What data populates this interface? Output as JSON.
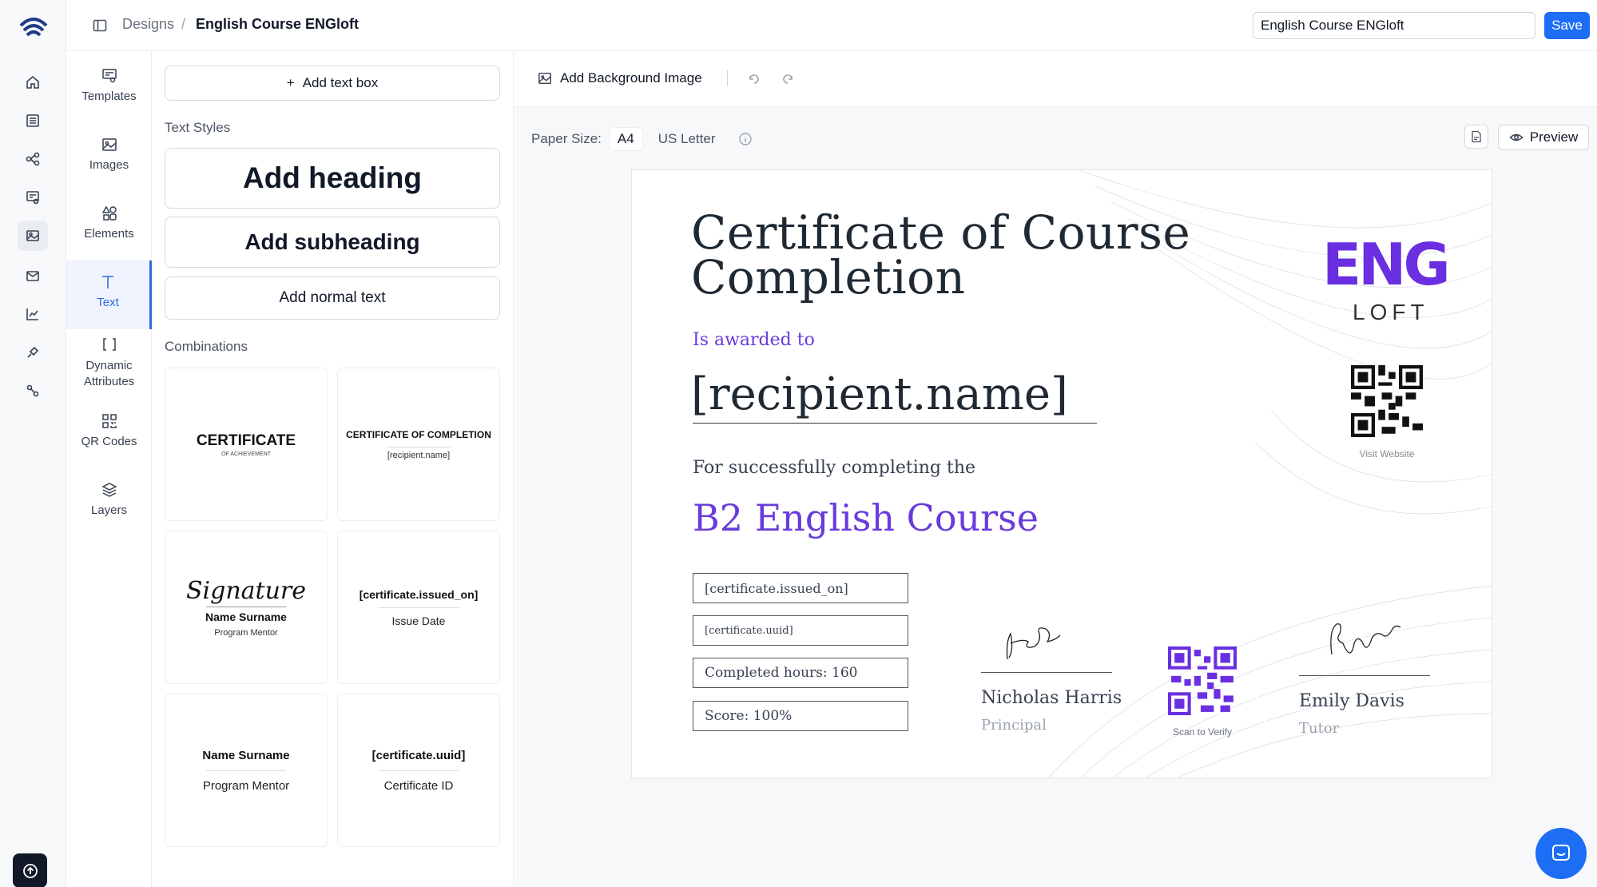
{
  "breadcrumb": {
    "root": "Designs",
    "separator": "/",
    "current": "English Course ENGloft"
  },
  "header": {
    "title_value": "English Course ENGloft",
    "save_label": "Save"
  },
  "rail": {
    "items": [
      "home-icon",
      "list-icon",
      "hierarchy-icon",
      "certificate-icon",
      "image-icon",
      "mail-icon",
      "chart-icon",
      "integration-icon",
      "link-icon"
    ],
    "active_index": 4
  },
  "tooltabs": [
    {
      "label": "Templates",
      "icon": "templates-icon"
    },
    {
      "label": "Images",
      "icon": "image-icon"
    },
    {
      "label": "Elements",
      "icon": "shapes-icon"
    },
    {
      "label": "Text",
      "icon": "text-icon"
    },
    {
      "label": "Dynamic Attributes",
      "icon": "brackets-icon"
    },
    {
      "label": "QR Codes",
      "icon": "qr-icon"
    },
    {
      "label": "Layers",
      "icon": "layers-icon"
    }
  ],
  "panel": {
    "add_text_box": "Add text box",
    "text_styles_label": "Text Styles",
    "add_heading": "Add heading",
    "add_subheading": "Add subheading",
    "add_normal": "Add normal text",
    "combinations_label": "Combinations",
    "combos": {
      "c1_title": "CERTIFICATE",
      "c1_sub": "OF ACHIEVEMENT",
      "c2_title": "CERTIFICATE OF COMPLETION",
      "c2_sub": "[recipient.name]",
      "c3_script": "Signature",
      "c3_name": "Name Surname",
      "c3_role": "Program Mentor",
      "c4_title": "[certificate.issued_on]",
      "c4_sub": "Issue Date",
      "c5_name": "Name Surname",
      "c5_role": "Program Mentor",
      "c6_title": "[certificate.uuid]",
      "c6_sub": "Certificate ID"
    }
  },
  "toolbar": {
    "background_label": "Add Background Image"
  },
  "paper": {
    "label": "Paper Size:",
    "options": [
      "A4",
      "US Letter"
    ],
    "selected": "A4",
    "preview_label": "Preview"
  },
  "certificate": {
    "title_line1": "Certificate of Course",
    "title_line2": "Completion",
    "awarded": "Is awarded to",
    "recipient": "[recipient.name]",
    "completing": "For successfully completing the",
    "course": "B2 English Course",
    "field_issued": "[certificate.issued_on]",
    "field_uuid": "[certificate.uuid]",
    "field_hours": "Completed hours: 160",
    "field_score": "Score: 100%",
    "signer1_name": "Nicholas Harris",
    "signer1_role": "Principal",
    "signer2_name": "Emily Davis",
    "signer2_role": "Tutor",
    "qr_verify_label": "Scan to Verify",
    "qr_website_label": "Visit Website",
    "logo_top": "ENG",
    "logo_bottom": "LOFT"
  },
  "colors": {
    "accent": "#1d6ef5",
    "brand_purple": "#6a3bdc",
    "active_tab": "#2d6cdf"
  }
}
